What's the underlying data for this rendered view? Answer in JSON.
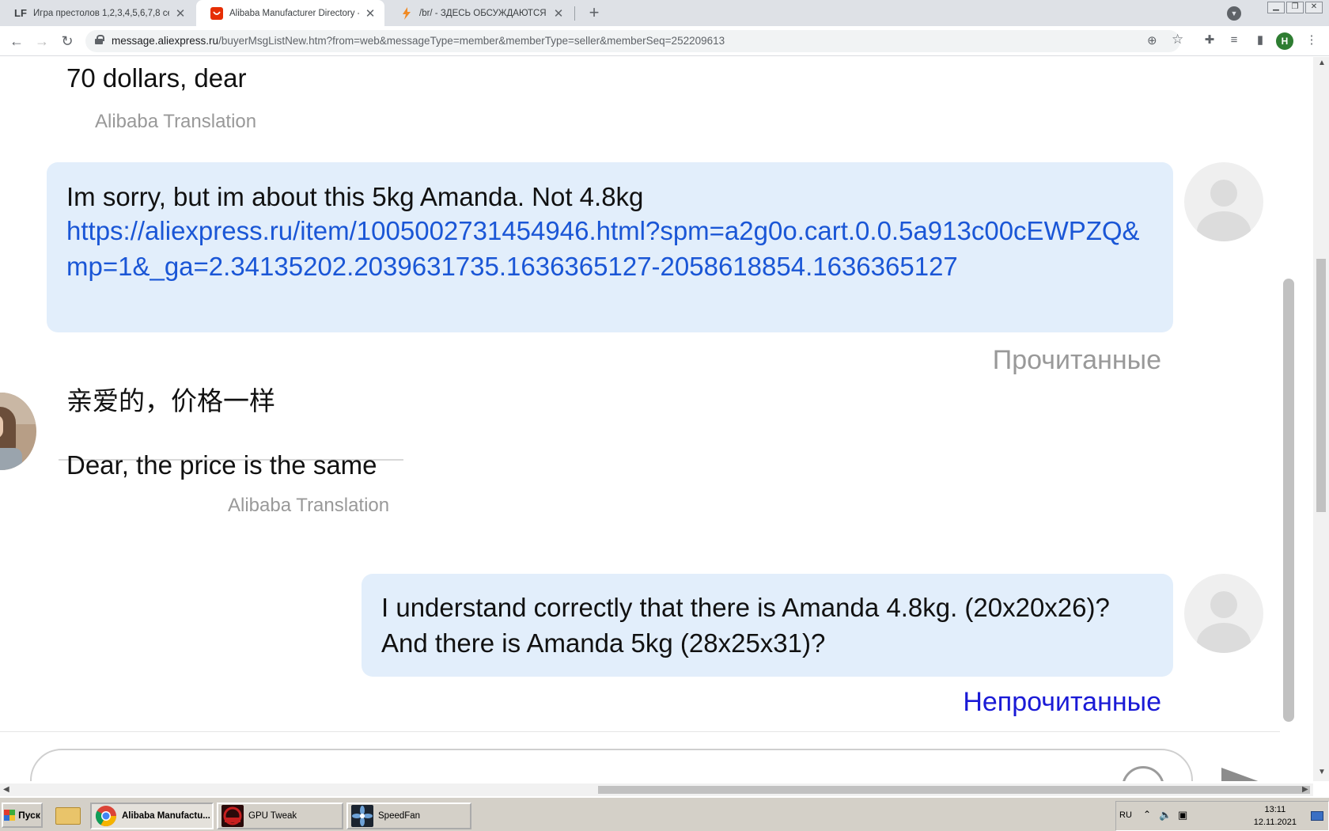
{
  "browser": {
    "tabs": [
      {
        "favicon": "LF",
        "title": "Игра престолов 1,2,3,4,5,6,7,8 сез"
      },
      {
        "favicon": "aliexpress-icon",
        "title": "Alibaba Manufacturer Directory - Su"
      },
      {
        "favicon": "bolt-icon",
        "title": "/br/ - ЗДЕСЬ ОБСУЖДАЮТСЯ РЕЗУ"
      }
    ],
    "url_host": "message.aliexpress.ru",
    "url_rest": "/buyerMsgListNew.htm?from=web&messageType=member&memberType=seller&memberSeq=252209613",
    "profile_initial": "H"
  },
  "chat": {
    "msg1": {
      "text": "70 dollars, dear",
      "translation_label": "Alibaba Translation"
    },
    "msg2": {
      "text": "Im sorry, but im about this 5kg Amanda. Not 4.8kg",
      "link": "https://aliexpress.ru/item/1005002731454946.html?spm=a2g0o.cart.0.0.5a913c00cEWPZQ&mp=1&_ga=2.34135202.2039631735.1636365127-2058618854.1636365127",
      "status": "Прочитанные"
    },
    "msg3": {
      "original": "亲爱的，价格一样",
      "translated": "Dear, the price is the same",
      "translation_label": "Alibaba Translation"
    },
    "msg4": {
      "line1": "I understand correctly that there is Amanda 4.8kg. (20x20x26)?",
      "line2": "And there is Amanda 5kg (28x25x31)?",
      "status": "Непрочитанные"
    },
    "colors": {
      "bubble": "#e2eefb",
      "link": "#1a56d6",
      "read": "#999999",
      "unread": "#1a1ad6"
    }
  },
  "taskbar": {
    "start_label": "Пуск",
    "tasks": [
      {
        "label": "Alibaba Manufactu..."
      },
      {
        "label": "GPU Tweak"
      },
      {
        "label": "SpeedFan"
      }
    ],
    "lang": "RU",
    "time": "13:11",
    "date": "12.11.2021"
  }
}
